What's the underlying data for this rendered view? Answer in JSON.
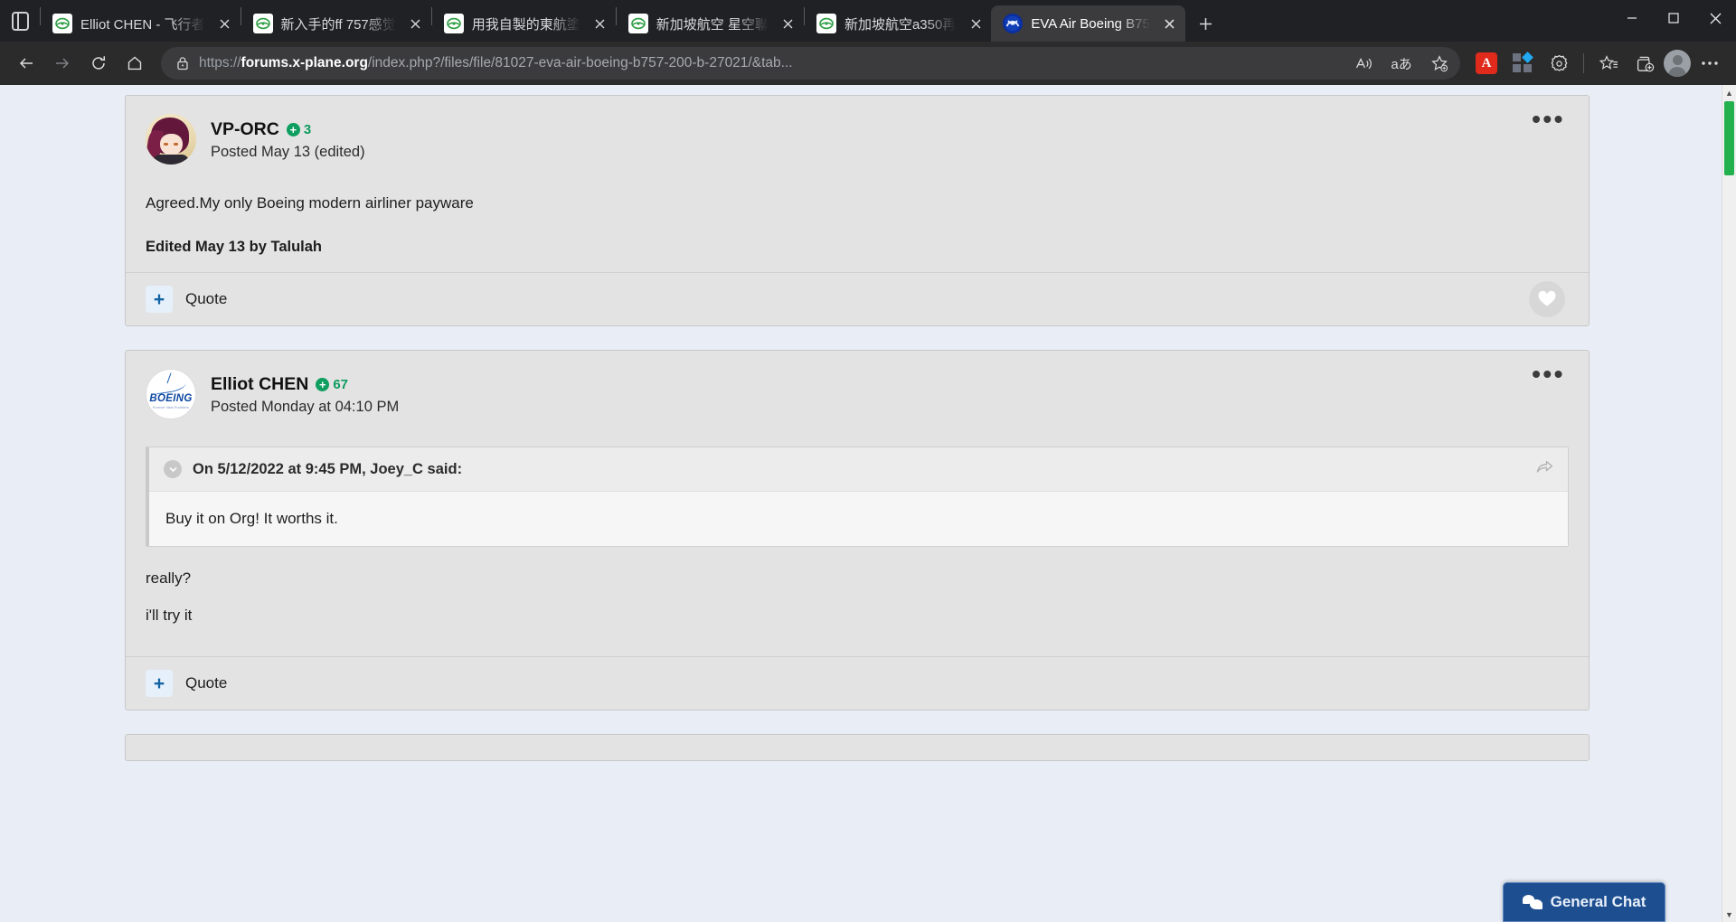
{
  "browser": {
    "tab_search_title": "Tab search",
    "tabs": [
      {
        "title": "Elliot CHEN - 飞行者",
        "favicon": "x-plane-icon",
        "active": false
      },
      {
        "title": "新入手的ff 757感觉",
        "favicon": "x-plane-icon",
        "active": false
      },
      {
        "title": "用我自製的東航塗",
        "favicon": "x-plane-icon",
        "active": false
      },
      {
        "title": "新加坡航空 星空聯",
        "favicon": "x-plane-icon",
        "active": false
      },
      {
        "title": "新加坡航空a350再",
        "favicon": "x-plane-icon",
        "active": false
      },
      {
        "title": "EVA Air Boeing B75",
        "favicon": "eva-air-icon",
        "active": true
      }
    ],
    "new_tab_label": "+",
    "window_controls": {
      "minimize": "–",
      "maximize": "☐",
      "close": "✕"
    },
    "nav": {
      "back": "back-arrow",
      "forward": "forward-arrow",
      "refresh": "refresh-arrow",
      "home": "home-house"
    },
    "omnibox": {
      "lock": "lock-icon",
      "scheme": "https://",
      "host": "forums.x-plane.org",
      "path": "/index.php?/files/file/81027-eva-air-boeing-b757-200-b-27021/&tab...",
      "read_aloud": "read-aloud-icon",
      "translate": "aあ",
      "favorite": "add-favorite-star"
    },
    "toolbar_icons": [
      "adobe-acrobat-extension",
      "extensions-grid",
      "browser-essentials",
      "favorites-star",
      "collections",
      "profile-avatar",
      "settings-ellipsis"
    ]
  },
  "page": {
    "posts": [
      {
        "author": "VP-ORC",
        "reputation": "3",
        "reputation_badge": "+",
        "date": "Posted May 13 (edited)",
        "avatar": "anime-avatar",
        "menu": "•••",
        "body": "Agreed.My only Boeing modern airliner payware",
        "edited": "Edited May 13 by Talulah",
        "quote_button": {
          "icon": "+",
          "label": "Quote"
        },
        "like_button": "heart-icon",
        "has_like": true
      },
      {
        "author": "Elliot CHEN",
        "reputation": "67",
        "reputation_badge": "+",
        "date": "Posted Monday at 04:10 PM",
        "avatar": "boeing-avatar",
        "avatar_text": "BOEING",
        "avatar_subtext": "Forever New Frontiers",
        "menu": "•••",
        "quote": {
          "cite": "On 5/12/2022 at 9:45 PM, Joey_C said:",
          "text": "Buy it on Org! It worths it.",
          "collapse_icon": "chevron-down-icon",
          "share_icon": "share-arrow-icon"
        },
        "body_lines": [
          "really?",
          "i'll try it"
        ],
        "quote_button": {
          "icon": "+",
          "label": "Quote"
        },
        "has_like": false
      }
    ],
    "chat_widget": {
      "label": "General Chat",
      "icon": "chat-bubbles-icon"
    },
    "scrollbar": {
      "up": "▲",
      "down": "▼"
    }
  },
  "colors": {
    "accent_green": "#22b14c",
    "rep_green": "#0e9e5f",
    "chat_blue": "#1d4e8f",
    "page_bg": "#e9eef6",
    "post_bg": "#e3e3e3"
  }
}
